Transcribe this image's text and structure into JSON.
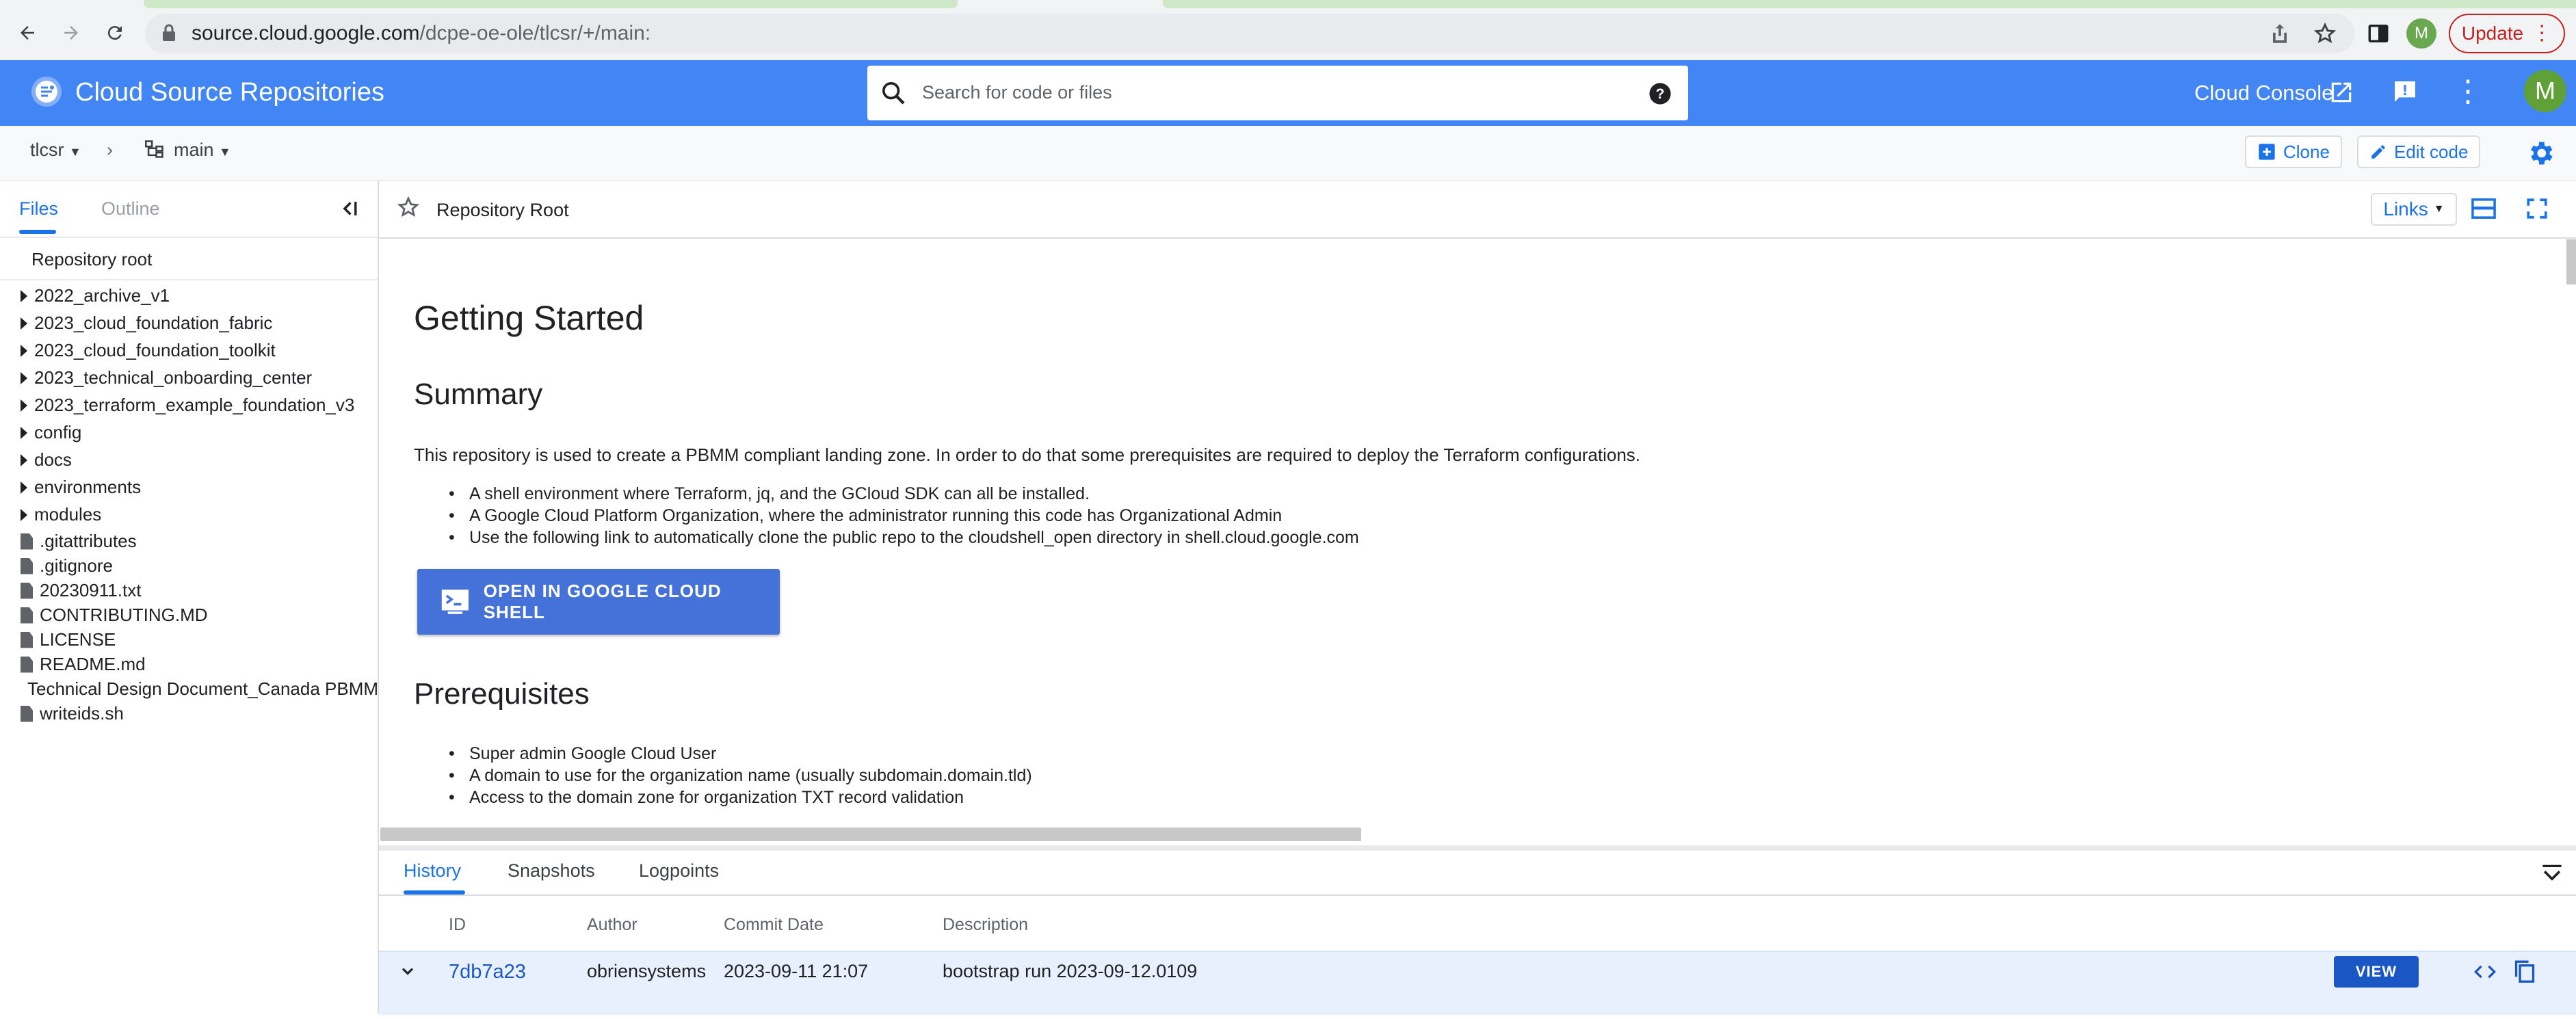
{
  "browser": {
    "url_host": "source.cloud.google.com",
    "url_path": "/dcpe-oe-ole/tlcsr/+/main:",
    "update_label": "Update",
    "profile_initial": "M"
  },
  "header": {
    "app_title": "Cloud Source Repositories",
    "search_placeholder": "Search for code or files",
    "cloud_console_label": "Cloud Console",
    "avatar_initial": "M"
  },
  "toolbar": {
    "repo": "tlcsr",
    "branch": "main",
    "clone_label": "Clone",
    "edit_code_label": "Edit code"
  },
  "sidebar": {
    "tabs": [
      {
        "label": "Files"
      },
      {
        "label": "Outline"
      }
    ],
    "root_label": "Repository root",
    "folders": [
      {
        "label": "2022_archive_v1"
      },
      {
        "label": "2023_cloud_foundation_fabric"
      },
      {
        "label": "2023_cloud_foundation_toolkit"
      },
      {
        "label": "2023_technical_onboarding_center"
      },
      {
        "label": "2023_terraform_example_foundation_v3"
      },
      {
        "label": "config"
      },
      {
        "label": "docs"
      },
      {
        "label": "environments"
      },
      {
        "label": "modules"
      }
    ],
    "files": [
      {
        "label": ".gitattributes"
      },
      {
        "label": ".gitignore"
      },
      {
        "label": "20230911.txt"
      },
      {
        "label": "CONTRIBUTING.MD"
      },
      {
        "label": "LICENSE"
      },
      {
        "label": "README.md"
      },
      {
        "label": "Technical Design Document_Canada PBMM"
      },
      {
        "label": "writeids.sh"
      }
    ]
  },
  "content": {
    "title": "Repository Root",
    "links_label": "Links",
    "h1": "Getting Started",
    "summary_heading": "Summary",
    "summary_text": "This repository is used to create a PBMM compliant landing zone. In order to do that some prerequisites are required to deploy the Terraform configurations.",
    "summary_bullets": [
      "A shell environment where Terraform, jq, and the GCloud SDK can all be installed.",
      "A Google Cloud Platform Organization, where the administrator running this code has Organizational Admin",
      "Use the following link to automatically clone the public repo to the cloudshell_open directory in shell.cloud.google.com"
    ],
    "cloud_shell_button": "OPEN IN GOOGLE CLOUD SHELL",
    "prereq_heading": "Prerequisites",
    "prereq_bullets": [
      "Super admin Google Cloud User",
      "A domain to use for the organization name (usually subdomain.domain.tld)",
      "Access to the domain zone for organization TXT record validation"
    ]
  },
  "bottom": {
    "tabs": [
      {
        "label": "History"
      },
      {
        "label": "Snapshots"
      },
      {
        "label": "Logpoints"
      }
    ],
    "columns": {
      "id": "ID",
      "author": "Author",
      "date": "Commit Date",
      "description": "Description"
    },
    "commit": {
      "id": "7db7a23",
      "author": "obriensystems",
      "date": "2023-09-11 21:07",
      "description": "bootstrap run 2023-09-12.0109",
      "view_label": "VIEW"
    }
  },
  "colors": {
    "brand_blue": "#4285f4",
    "link_blue": "#1a73e8",
    "update_red": "#c5221f"
  }
}
